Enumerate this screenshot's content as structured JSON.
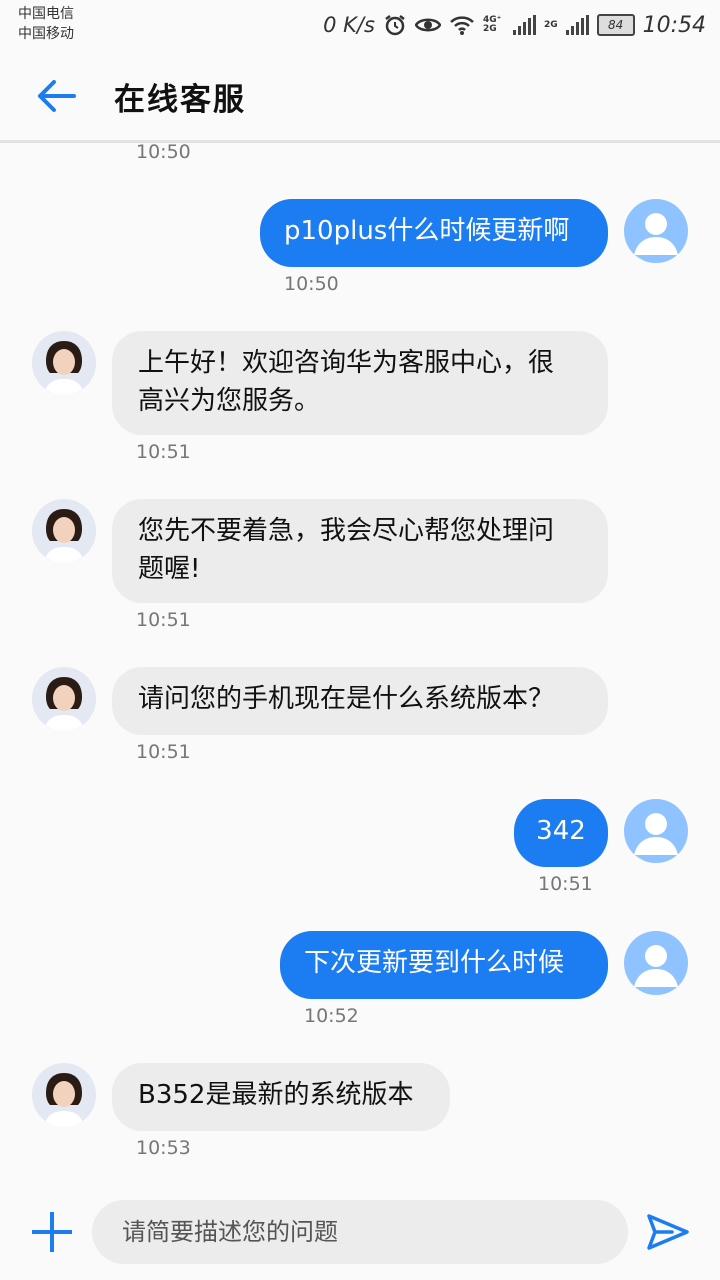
{
  "status_bar": {
    "carriers": [
      "中国电信",
      "中国移动"
    ],
    "net_speed": "0 K/s",
    "net_type_1": "4G⁺ 2G",
    "net_type_2": "2G",
    "battery": "84",
    "time": "10:54",
    "icons": [
      "alarm-icon",
      "eye-icon",
      "wifi-icon",
      "signal-icon",
      "battery-icon"
    ]
  },
  "header": {
    "title": "在线客服",
    "back_icon": "back-arrow-icon"
  },
  "messages": [
    {
      "time": "10:50"
    },
    {
      "from": "user",
      "text": "p10plus什么时候更新啊",
      "time": "10:50"
    },
    {
      "from": "agent",
      "lines": [
        "上午好！欢迎咨询华为客服中心，很",
        "高兴为您服务。"
      ],
      "time": "10:51"
    },
    {
      "from": "agent",
      "lines": [
        "您先不要着急，我会尽心帮您处理问",
        "题喔!"
      ],
      "time": "10:51"
    },
    {
      "from": "agent",
      "lines": [
        "请问您的手机现在是什么系统版本？"
      ],
      "time": "10:51"
    },
    {
      "from": "user",
      "text": "342",
      "time": "10:51"
    },
    {
      "from": "user",
      "text": "下次更新要到什么时候",
      "time": "10:52"
    },
    {
      "from": "agent",
      "lines": [
        "B352是最新的系统版本"
      ],
      "time": "10:53"
    }
  ],
  "composer": {
    "placeholder": "请简要描述您的问题",
    "plus_icon": "plus-icon",
    "send_icon": "send-icon"
  },
  "colors": {
    "accent": "#1c7cf2",
    "agent_bubble": "#ececec",
    "user_avatar": "#8fc3ff"
  }
}
